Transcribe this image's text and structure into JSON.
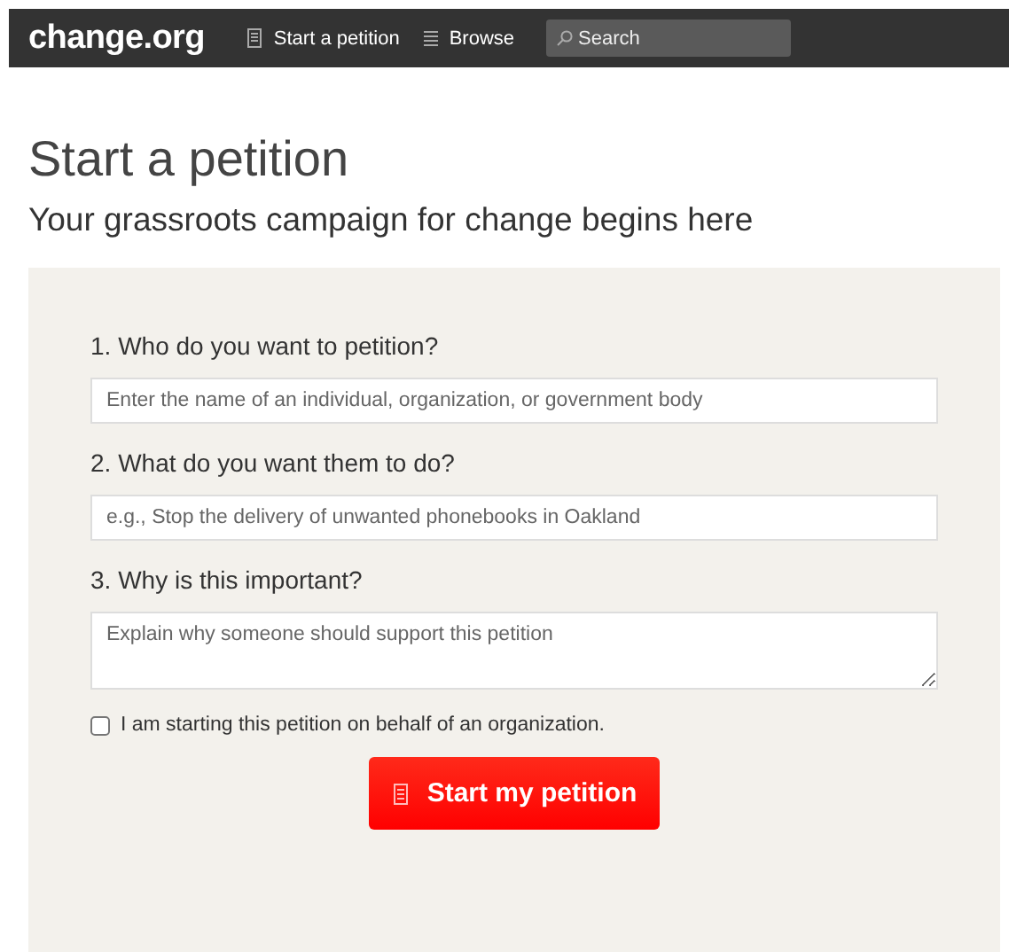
{
  "nav": {
    "logo": "change.org",
    "links": [
      {
        "label": "Start a petition"
      },
      {
        "label": "Browse"
      }
    ],
    "search": {
      "placeholder": "Search"
    }
  },
  "heading": "Start a petition",
  "subheading": "Your grassroots campaign for change begins here",
  "fields": [
    {
      "label": "1. Who do you want to petition?",
      "placeholder": "Enter the name of an individual, organization, or government body",
      "kind": "input"
    },
    {
      "label": "2. What do you want them to do?",
      "placeholder": "e.g., Stop the delivery of unwanted phonebooks in Oakland",
      "kind": "input"
    },
    {
      "label": "3. Why is this important?",
      "placeholder": "Explain why someone should support this petition",
      "kind": "textarea"
    }
  ],
  "organization": {
    "label": "I am starting this petition on behalf of an organization.",
    "checked": false
  },
  "submit": "Start my petition"
}
